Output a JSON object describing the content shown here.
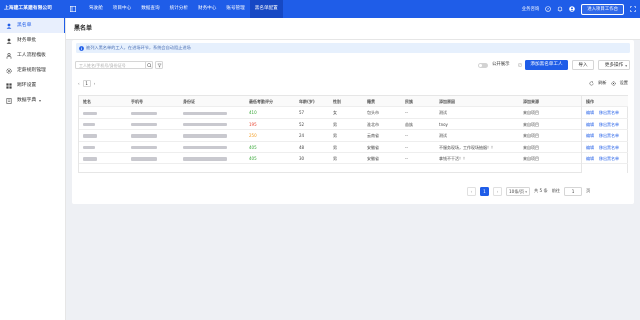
{
  "topbar": {
    "brand": "上海建工某建有限公司",
    "nav": [
      "驾驶舱",
      "项目中心",
      "数据查询",
      "统计分析",
      "财务中心",
      "账号管理",
      "黑名单配置"
    ],
    "active_nav": "黑名单配置",
    "right_link": "业务咨询",
    "workbench_button": "进入项目工作台"
  },
  "sidebar": {
    "items": [
      {
        "label": "黑名单",
        "icon": "user-icon",
        "active": true,
        "expandable": false
      },
      {
        "label": "财务审批",
        "icon": "user-icon",
        "active": false,
        "expandable": false
      },
      {
        "label": "工人流程模板",
        "icon": "person-icon",
        "active": false,
        "expandable": true
      },
      {
        "label": "定薪规则管理",
        "icon": "gear-icon",
        "active": false,
        "expandable": true
      },
      {
        "label": "踢环设置",
        "icon": "grid-icon",
        "active": false,
        "expandable": false
      },
      {
        "label": "数据字典",
        "icon": "book-icon",
        "active": false,
        "expandable": true
      }
    ]
  },
  "page": {
    "title": "黑名单"
  },
  "notice": "被列入黑名单的工人，在进场环节，系统会自动阻止进场",
  "toolbar": {
    "search_placeholder": "工人姓名/手机号/身份证号",
    "toggle_label": "公开展示",
    "add_button": "添加黑名单工人",
    "import_button": "导入",
    "more_button": "更多操作"
  },
  "table_top": {
    "page": "1",
    "refresh": "刷新",
    "settings": "设置"
  },
  "table": {
    "columns": [
      "姓名",
      "手机号",
      "身份证",
      "最低考勤评分",
      "年龄(岁)",
      "性别",
      "籍贯",
      "民族",
      "添加原因",
      "添加来源",
      "操作"
    ],
    "rows": [
      {
        "score": "410",
        "score_color": "green",
        "age": "57",
        "gender": "女",
        "origin": "包头市",
        "ethnic": "--",
        "reason": "测试",
        "source": "来自项目"
      },
      {
        "score": "195",
        "score_color": "red",
        "age": "52",
        "gender": "男",
        "origin": "淮北市",
        "ethnic": "苗族",
        "reason": "tnoy",
        "source": "来自项目"
      },
      {
        "score": "250",
        "score_color": "orange",
        "age": "24",
        "gender": "男",
        "origin": "云南省",
        "ethnic": "--",
        "reason": "测试",
        "source": "来自项目"
      },
      {
        "score": "405",
        "score_color": "green",
        "age": "48",
        "gender": "男",
        "origin": "安徽省",
        "ethnic": "--",
        "reason": "不服务现场，工作现场抽烟！！",
        "source": "来自项目"
      },
      {
        "score": "405",
        "score_color": "green",
        "age": "30",
        "gender": "男",
        "origin": "安徽省",
        "ethnic": "--",
        "reason": "拿钱不干活！！",
        "source": "来自项目"
      }
    ],
    "ops": [
      "编辑",
      "移出黑名单"
    ]
  },
  "pagination": {
    "current": "1",
    "page_size": "10条/页",
    "total": "共 5 条",
    "goto_label": "前往",
    "goto_value": "1",
    "page_unit": "页"
  },
  "colors": {
    "brand": "#1f5de8",
    "score_green": "#33a532",
    "score_red": "#e8432f",
    "score_orange": "#f39a1c"
  }
}
